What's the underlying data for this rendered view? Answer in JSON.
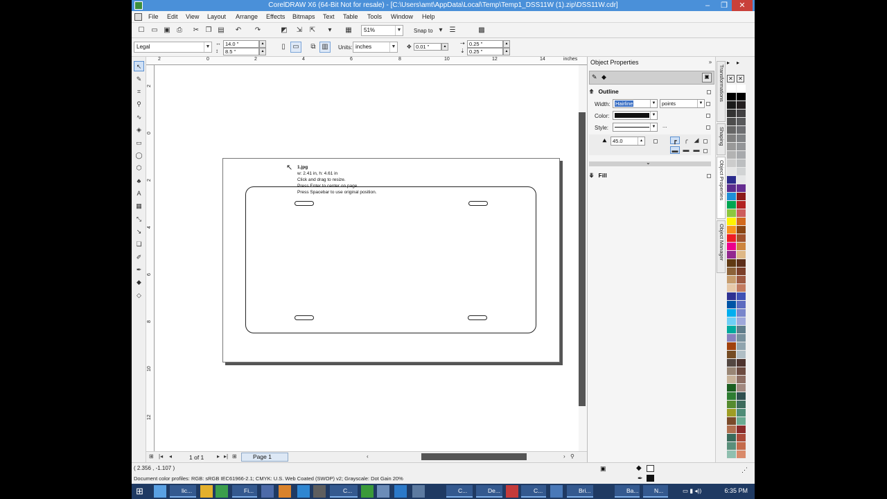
{
  "window": {
    "title": "CorelDRAW X6 (64-Bit Not for resale) - [C:\\Users\\amt\\AppData\\Local\\Temp\\Temp1_DSS11W (1).zip\\DSS11W.cdr]",
    "minimize": "–",
    "restore": "❐",
    "close": "✕"
  },
  "menu": [
    "File",
    "Edit",
    "View",
    "Layout",
    "Arrange",
    "Effects",
    "Bitmaps",
    "Text",
    "Table",
    "Tools",
    "Window",
    "Help"
  ],
  "standard_toolbar": {
    "zoom": "51%",
    "snap_to": "Snap to"
  },
  "property_bar": {
    "page_size": "Legal",
    "width": "14.0 \"",
    "height": "8.5 \"",
    "units_label": "Units:",
    "units": "inches",
    "nudge": "0.01 \"",
    "dup_x": "0.25 \"",
    "dup_y": "0.25 \""
  },
  "ruler": {
    "h_labels": [
      "2",
      "0",
      "2",
      "4",
      "6",
      "8",
      "10",
      "12",
      "14"
    ],
    "unit": "inches",
    "v_labels": [
      "2",
      "0",
      "2",
      "4",
      "6",
      "8",
      "10",
      "12"
    ]
  },
  "canvas": {
    "tooltip": {
      "title": "1.jpg",
      "size": "w: 2.41 in, h: 4.61 in",
      "line1": "Click and drag to resize.",
      "line2": "Press Enter to center on page.",
      "line3": "Press Spacebar to use original position."
    }
  },
  "doc_nav": {
    "page_count": "1 of 1",
    "page_tab": "Page 1"
  },
  "status": {
    "coords": "( 2.356 , -1.107 )",
    "profiles": "Document color profiles: RGB: sRGB IEC61966-2.1; CMYK: U.S. Web Coated (SWOP) v2; Grayscale: Dot Gain 20%"
  },
  "docker": {
    "title": "Object Properties",
    "outline": {
      "header": "Outline",
      "width_label": "Width:",
      "width_value": "Hairline",
      "width_unit": "points",
      "color_label": "Color:",
      "style_label": "Style:",
      "style_more": "...",
      "miter": "45.0"
    },
    "fill": {
      "header": "Fill"
    },
    "side_tabs": [
      "Transformations",
      "Shaping",
      "Object Properties",
      "Object Manager"
    ]
  },
  "palette_colors": {
    "left": [
      "#ffffff",
      "#000000",
      "#1a1a1a",
      "#333333",
      "#4d4d4d",
      "#666666",
      "#808080",
      "#999999",
      "#b3b3b3",
      "#cccccc",
      "#e6e6e6",
      "#2b2b8c",
      "#5b2c8c",
      "#1e8fd6",
      "#00a651",
      "#8dc63f",
      "#fff200",
      "#f7941d",
      "#ed1c24",
      "#ec008c",
      "#92278f",
      "#603913",
      "#8c6239",
      "#c69c6d",
      "#e6c8a8",
      "#2e3192",
      "#0054a6",
      "#00aeef",
      "#6dcff6",
      "#00a99d",
      "#8781bd",
      "#a0410d",
      "#754c24",
      "#534741",
      "#998675",
      "#c7b299",
      "#1b5e20",
      "#2e7d32",
      "#558b2f",
      "#9e9d24",
      "#7a4a2a",
      "#b07050",
      "#3a6b5b",
      "#5a8f7b",
      "#8fbfaf"
    ],
    "right": [
      "#ffffff",
      "#000000",
      "#231f20",
      "#414042",
      "#58595b",
      "#6d6e71",
      "#808285",
      "#939598",
      "#a7a9ac",
      "#bcbec0",
      "#d1d3d4",
      "#e6e7e8",
      "#662d91",
      "#8b1a1a",
      "#b22222",
      "#cd5c5c",
      "#d2691e",
      "#8b4513",
      "#a0522d",
      "#cd853f",
      "#deb887",
      "#5c2e1a",
      "#7b3f2a",
      "#9e5a43",
      "#c27b61",
      "#3f51b5",
      "#5c6bc0",
      "#7986cb",
      "#9fa8da",
      "#607d8b",
      "#78909c",
      "#90a4ae",
      "#b0bec5",
      "#4e342e",
      "#6d4c41",
      "#8d6e63",
      "#a1887f",
      "#2f4f4f",
      "#3d6b5c",
      "#4e8c77",
      "#6aaa92",
      "#8a2b2b",
      "#aa4a3a",
      "#c46a4a",
      "#d98a6a"
    ]
  },
  "taskbar": {
    "items": [
      "lic...",
      "Fi...",
      "C...",
      "C...",
      "De...",
      "C...",
      "Bri...",
      "Ba...",
      "N..."
    ],
    "time": "6:35 PM"
  }
}
